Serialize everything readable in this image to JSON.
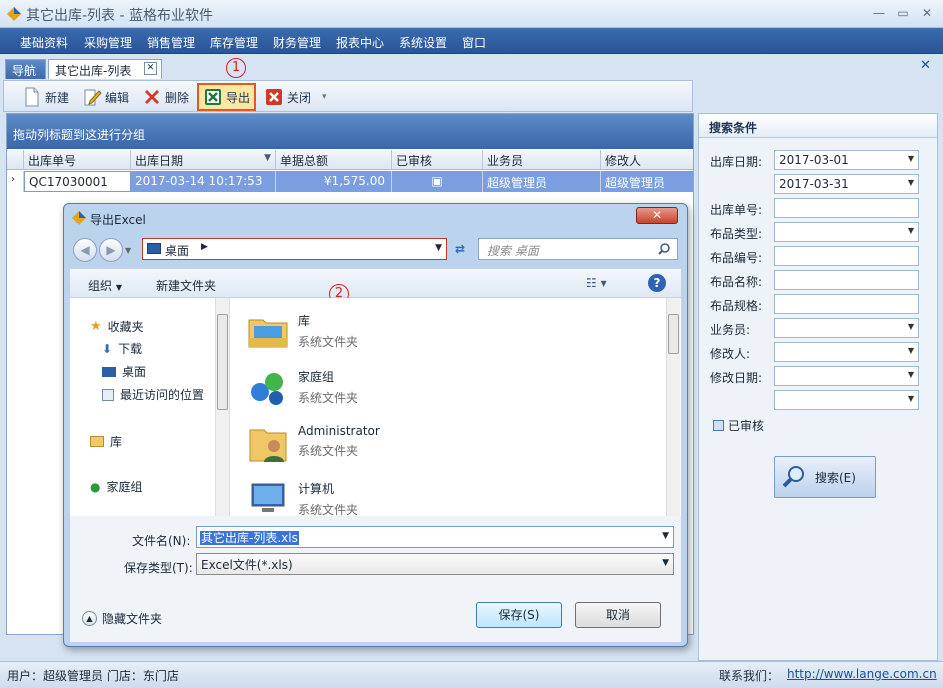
{
  "app": {
    "title": "其它出库-列表 - 蓝格布业软件"
  },
  "menu": [
    "基础资料",
    "采购管理",
    "销售管理",
    "库存管理",
    "财务管理",
    "报表中心",
    "系统设置",
    "窗口"
  ],
  "tabs": {
    "nav": "导航",
    "list": "其它出库-列表"
  },
  "toolbar": {
    "new": "新建",
    "edit": "编辑",
    "delete": "删除",
    "export": "导出",
    "close": "关闭"
  },
  "grid": {
    "group_hint": "拖动列标题到这进行分组",
    "columns": [
      "出库单号",
      "出库日期",
      "单据总额",
      "已审核",
      "业务员",
      "修改人"
    ],
    "rows": [
      {
        "no": "QC17030001",
        "date": "2017-03-14 10:17:53",
        "total": "¥1,575.00",
        "checked": "▣",
        "staff": "超级管理员",
        "modifier": "超级管理员"
      }
    ]
  },
  "search": {
    "title": "搜索条件",
    "date_label": "出库日期:",
    "date_from": "2017-03-01",
    "date_to": "2017-03-31",
    "fields": [
      "出库单号:",
      "布品类型:",
      "布品编号:",
      "布品名称:",
      "布品规格:",
      "业务员:",
      "修改人:",
      "修改日期:"
    ],
    "approved": "已审核",
    "button": "搜索(E)"
  },
  "dialog": {
    "title": "导出Excel",
    "address": "桌面",
    "search_placeholder": "搜索 桌面",
    "organize": "组织",
    "new_folder": "新建文件夹",
    "nav": {
      "favorites": "收藏夹",
      "downloads": "下载",
      "desktop": "桌面",
      "recent": "最近访问的位置",
      "library": "库",
      "homegroup": "家庭组"
    },
    "files": [
      {
        "name": "库",
        "type": "系统文件夹"
      },
      {
        "name": "家庭组",
        "type": "系统文件夹"
      },
      {
        "name": "Administrator",
        "type": "系统文件夹"
      },
      {
        "name": "计算机",
        "type": "系统文件夹"
      }
    ],
    "filename_label": "文件名(N):",
    "filename": "其它出库-列表.xls",
    "filetype_label": "保存类型(T):",
    "filetype": "Excel文件(*.xls)",
    "hide_folders": "隐藏文件夹",
    "save": "保存(S)",
    "cancel": "取消"
  },
  "markers": {
    "one": "1",
    "two": "2"
  },
  "status": {
    "user": "用户：超级管理员  门店：东门店",
    "contact": "联系我们：",
    "url": "http://www.lange.com.cn"
  }
}
